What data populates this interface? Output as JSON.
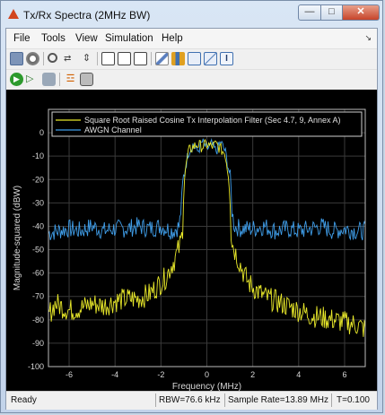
{
  "window": {
    "title": "Tx/Rx Spectra (2MHz BW)"
  },
  "menu": {
    "items": [
      "File",
      "Tools",
      "View",
      "Simulation",
      "Help"
    ]
  },
  "toolbar1_icons": [
    "print-icon",
    "settings-icon",
    "zoom-in-icon",
    "zoom-x-icon",
    "zoom-y-icon",
    "autoscale-icon",
    "autoscale-x-icon",
    "autoscale-y-icon",
    "edit-icon",
    "measure-icon",
    "spectrum-settings-icon",
    "cursor-measure-icon",
    "channel-measure-icon"
  ],
  "toolbar2_icons": [
    "run-icon",
    "step-forward-icon",
    "stop-icon",
    "highlight-icon",
    "snapshot-icon"
  ],
  "status": {
    "ready": "Ready",
    "rbw": "RBW=76.6 kHz",
    "sample_rate": "Sample Rate=13.89 MHz",
    "time": "T=0.100"
  },
  "chart_data": {
    "type": "line",
    "xlabel": "Frequency (MHz)",
    "ylabel": "Magnitude-squared (dBW)",
    "xlim": [
      -6.9,
      6.9
    ],
    "ylim": [
      -100,
      10
    ],
    "xticks": [
      "-6",
      "-4",
      "-2",
      "0",
      "2",
      "4",
      "6"
    ],
    "yticks": [
      "0",
      "-10",
      "-20",
      "-30",
      "-40",
      "-50",
      "-60",
      "-70",
      "-80",
      "-90",
      "-100"
    ],
    "grid": true,
    "legend_placement": "top-left",
    "colors": {
      "tx": "#e8e82a",
      "awgn": "#3f9de8",
      "background": "#000000",
      "grid": "#3a3a3a",
      "axis_text": "#d8d8d8"
    },
    "series": [
      {
        "name": "Square Root Raised Cosine Tx Interpolation Filter (Sec 4.7, 9, Annex A)",
        "x": [
          -6.9,
          -6.6,
          -6.0,
          -5.5,
          -5.0,
          -4.5,
          -4.0,
          -3.5,
          -3.0,
          -2.5,
          -2.0,
          -1.8,
          -1.6,
          -1.4,
          -1.2,
          -1.1,
          -1.05,
          -1.0,
          -0.8,
          -0.6,
          -0.4,
          -0.2,
          0,
          0.2,
          0.4,
          0.6,
          0.8,
          1.0,
          1.05,
          1.1,
          1.2,
          1.4,
          1.6,
          1.8,
          2.0,
          2.5,
          3.0,
          3.5,
          4.0,
          4.5,
          5.0,
          5.5,
          6.0,
          6.5,
          6.9
        ],
        "y": [
          -78,
          -73,
          -76,
          -75,
          -73,
          -74,
          -72,
          -71,
          -71,
          -69,
          -64,
          -62,
          -58,
          -54,
          -49,
          -45,
          -40,
          -20,
          -8,
          -6,
          -5,
          -6,
          -5,
          -6,
          -5,
          -7,
          -9,
          -22,
          -42,
          -47,
          -50,
          -55,
          -60,
          -64,
          -66,
          -70,
          -72,
          -74,
          -76,
          -78,
          -79,
          -80,
          -81,
          -82,
          -84
        ]
      },
      {
        "name": "AWGN Channel",
        "x": [
          -6.9,
          -6.5,
          -6.0,
          -5.5,
          -5.0,
          -4.5,
          -4.0,
          -3.5,
          -3.0,
          -2.5,
          -2.0,
          -1.5,
          -1.2,
          -1.1,
          -1.05,
          -1.0,
          -0.8,
          -0.6,
          -0.4,
          -0.2,
          0,
          0.2,
          0.4,
          0.6,
          0.8,
          1.0,
          1.05,
          1.1,
          1.2,
          1.5,
          2.0,
          2.5,
          3.0,
          3.5,
          4.0,
          4.5,
          5.0,
          5.5,
          6.0,
          6.5,
          6.9
        ],
        "y": [
          -43,
          -42,
          -41,
          -42,
          -40,
          -42,
          -41,
          -41,
          -40,
          -41,
          -40,
          -42,
          -40,
          -30,
          -22,
          -18,
          -8,
          -5,
          -8,
          -4,
          -7,
          -5,
          -8,
          -4,
          -8,
          -18,
          -24,
          -34,
          -40,
          -41,
          -41,
          -40,
          -42,
          -41,
          -42,
          -41,
          -40,
          -42,
          -41,
          -42,
          -42
        ]
      }
    ]
  }
}
